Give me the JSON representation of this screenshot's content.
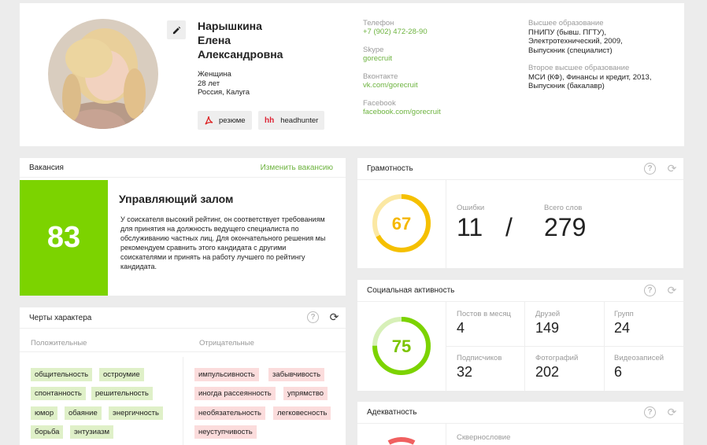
{
  "profile": {
    "name_line1": "Нарышкина",
    "name_line2": "Елена",
    "name_line3": "Александровна",
    "gender": "Женщина",
    "age": "28 лет",
    "location": "Россия, Калуга",
    "resume_label": "резюме",
    "resume_icon": "pdf-icon",
    "hh_label": "headhunter",
    "hh_icon_text": "hh"
  },
  "contacts": {
    "phone_label": "Телефон",
    "phone": "+7 (902) 472-28-90",
    "skype_label": "Skype",
    "skype": "gorecruit",
    "vk_label": "Вконтакте",
    "vk": "vk.com/gorecruit",
    "fb_label": "Facebook",
    "fb": "facebook.com/gorecruit"
  },
  "education": {
    "higher_label": "Высшее образование",
    "higher_line1": "ПНИПУ (бывш. ПГТУ),",
    "higher_line2": "Электротехнический, 2009,",
    "higher_line3": "Выпускник (специалист)",
    "second_label": "Второе высшее образование",
    "second_line1": "МСИ (КФ), Финансы и кредит, 2013,",
    "second_line2": "Выпускник (бакалавр)"
  },
  "vacancy": {
    "header": "Вакансия",
    "change_link": "Изменить вакансию",
    "score": "83",
    "title": "Управляющий залом",
    "description": "У соискателя высокий рейтинг, он соответствует требованиям для принятия на должность ведущего специалиста по обслуживанию частных лиц. Для окончательного решения мы рекомендуем сравнить этого кандидата с другими соискателями и принять на работу лучшего по рейтингу кандидата."
  },
  "traits": {
    "header": "Черты характера",
    "positive_label": "Положительные",
    "negative_label": "Отрицательные",
    "positive": [
      "общительность",
      "остроумие",
      "спонтанность",
      "решительность",
      "юмор",
      "обаяние",
      "энергичность",
      "борьба",
      "энтузиазм"
    ],
    "negative": [
      "импульсивность",
      "забывчивость",
      "иногда рассеянность",
      "упрямство",
      "необязательность",
      "легковесность",
      "неуступчивость"
    ]
  },
  "literacy": {
    "header": "Грамотность",
    "score": "67",
    "score_fraction": 0.67,
    "ring_color": "#f5c000",
    "errors_label": "Ошибки",
    "errors": "11",
    "separator": "/",
    "words_label": "Всего слов",
    "words": "279"
  },
  "social": {
    "header": "Социальная активность",
    "score": "75",
    "score_fraction": 0.75,
    "ring_color": "#7cd300",
    "posts_label": "Постов в месяц",
    "posts": "4",
    "friends_label": "Друзей",
    "friends": "149",
    "groups_label": "Групп",
    "groups": "24",
    "subscribers_label": "Подписчиков",
    "subscribers": "32",
    "photos_label": "Фотографий",
    "photos": "202",
    "videos_label": "Видеозаписей",
    "videos": "6"
  },
  "adequacy": {
    "header": "Адекватность",
    "profanity_label": "Сквернословие",
    "ring_color": "#f06060"
  },
  "colors": {
    "accent_green": "#7cd300",
    "link_green": "#6db33f",
    "positive_tag": "#dff0c8",
    "negative_tag": "#fbdcdc"
  }
}
